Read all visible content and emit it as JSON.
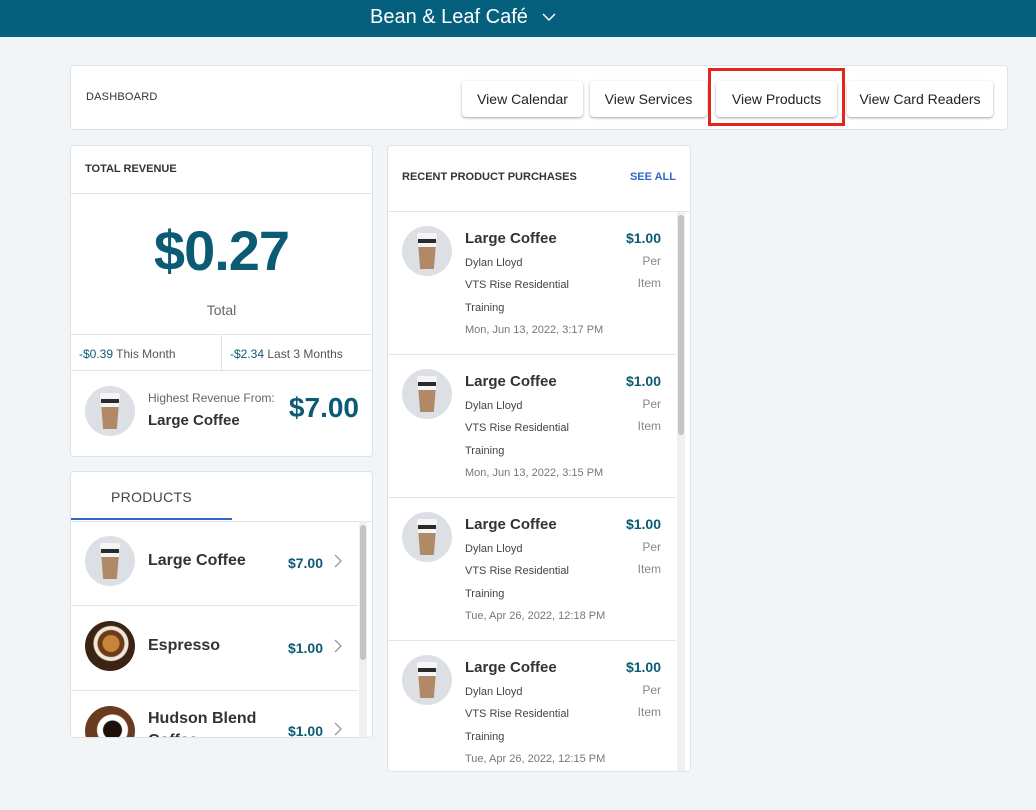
{
  "header": {
    "title": "Bean & Leaf Café",
    "dropdown_icon": "chevron-down-icon"
  },
  "dashboard": {
    "label": "DASHBOARD",
    "buttons": [
      "View Calendar",
      "View Services",
      "View Products",
      "View Card Readers"
    ],
    "highlighted_button": "View Products",
    "highlight_color": "#e3251b"
  },
  "revenue": {
    "title": "TOTAL REVENUE",
    "amount": "$0.27",
    "amount_label": "Total",
    "this_month": {
      "value": "-$0.39",
      "label": "This Month"
    },
    "last_3_months": {
      "value": "-$2.34",
      "label": "Last 3 Months"
    },
    "highest": {
      "label": "Highest Revenue From:",
      "name": "Large Coffee",
      "value": "$7.00"
    }
  },
  "products": {
    "tab": "PRODUCTS",
    "items": [
      {
        "name": "Large Coffee",
        "price": "$7.00",
        "icon": "coffee-cup-icon"
      },
      {
        "name": "Espresso",
        "price": "$1.00",
        "icon": "espresso-icon"
      },
      {
        "name": "Hudson Blend Coffee",
        "price": "$1.00",
        "icon": "coffee-mug-icon"
      }
    ]
  },
  "recent": {
    "title": "RECENT PRODUCT PURCHASES",
    "see_all": "SEE ALL",
    "items": [
      {
        "name": "Large Coffee",
        "customer": "Dylan Lloyd",
        "org_line1": "VTS Rise Residential",
        "org_line2": "Training",
        "date": "Mon, Jun 13, 2022, 3:17 PM",
        "price": "$1.00",
        "unit1": "Per",
        "unit2": "Item"
      },
      {
        "name": "Large Coffee",
        "customer": "Dylan Lloyd",
        "org_line1": "VTS Rise Residential",
        "org_line2": "Training",
        "date": "Mon, Jun 13, 2022, 3:15 PM",
        "price": "$1.00",
        "unit1": "Per",
        "unit2": "Item"
      },
      {
        "name": "Large Coffee",
        "customer": "Dylan Lloyd",
        "org_line1": "VTS Rise Residential",
        "org_line2": "Training",
        "date": "Tue, Apr 26, 2022, 12:18 PM",
        "price": "$1.00",
        "unit1": "Per",
        "unit2": "Item"
      },
      {
        "name": "Large Coffee",
        "customer": "Dylan Lloyd",
        "org_line1": "VTS Rise Residential",
        "org_line2": "Training",
        "date": "Tue, Apr 26, 2022, 12:15 PM",
        "price": "$1.00",
        "unit1": "Per",
        "unit2": "Item"
      }
    ]
  },
  "colors": {
    "brand": "#04607d",
    "accent": "#0b5b74",
    "link": "#2f67c8"
  }
}
